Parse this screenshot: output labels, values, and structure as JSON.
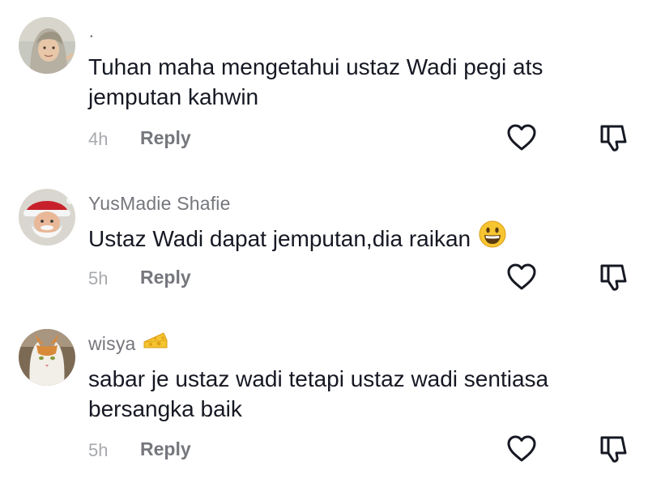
{
  "comments": [
    {
      "username": "·",
      "text": "Tuhan maha mengetahui ustaz Wadi pegi ats jemputan kahwin",
      "time": "4h",
      "reply_label": "Reply",
      "avatar": "avatar-hijab-girl"
    },
    {
      "username": "YusMadie Shafie",
      "text": "Ustaz Wadi dapat jemputan,dia raikan",
      "emoji": "grinning-face-emoji",
      "time": "5h",
      "reply_label": "Reply",
      "avatar": "avatar-santa"
    },
    {
      "username": "wisya",
      "badge": "cheese-emoji",
      "text": "sabar je ustaz wadi tetapi ustaz wadi sentiasa bersangka baik",
      "time": "5h",
      "reply_label": "Reply",
      "avatar": "avatar-cat"
    }
  ],
  "icons": {
    "like": "heart-outline-icon",
    "dislike": "thumbs-down-outline-icon"
  },
  "colors": {
    "text": "#161823",
    "username": "#75777d",
    "timestamp": "#a7a9ad",
    "icon": "#161823"
  }
}
